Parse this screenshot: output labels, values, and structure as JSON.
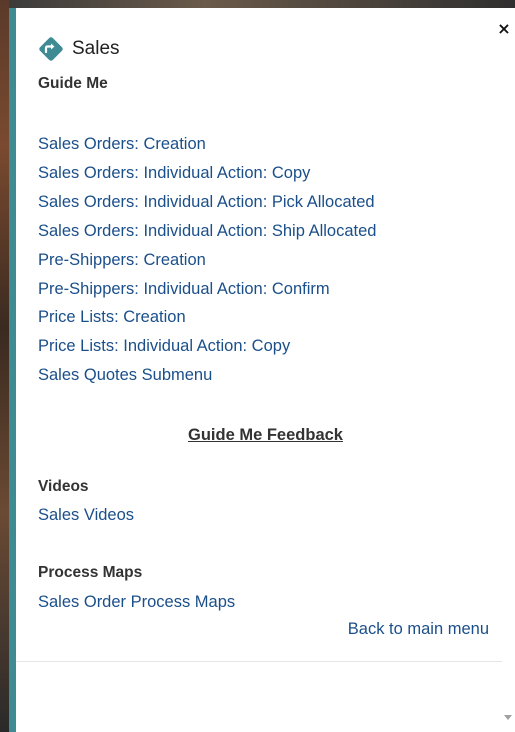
{
  "panel": {
    "title": "Sales",
    "close_symbol": "×",
    "accent_color": "#3f8b93"
  },
  "guide_me": {
    "heading": "Guide Me",
    "links": [
      "Sales Orders: Creation",
      "Sales Orders: Individual Action: Copy",
      "Sales Orders: Individual Action: Pick Allocated",
      "Sales Orders: Individual Action: Ship Allocated",
      "Pre-Shippers: Creation",
      "Pre-Shippers: Individual Action: Confirm",
      "Price Lists: Creation",
      "Price Lists: Individual Action: Copy",
      "Sales Quotes Submenu"
    ],
    "feedback": "Guide Me Feedback"
  },
  "videos": {
    "heading": "Videos",
    "link": "Sales Videos"
  },
  "process_maps": {
    "heading": "Process Maps",
    "link": "Sales Order Process Maps"
  },
  "footer": {
    "back_link": "Back to main menu"
  },
  "icons": {
    "title_icon": "directions-diamond-icon",
    "close": "close-icon",
    "scroll": "scroll-down-arrow-icon"
  }
}
